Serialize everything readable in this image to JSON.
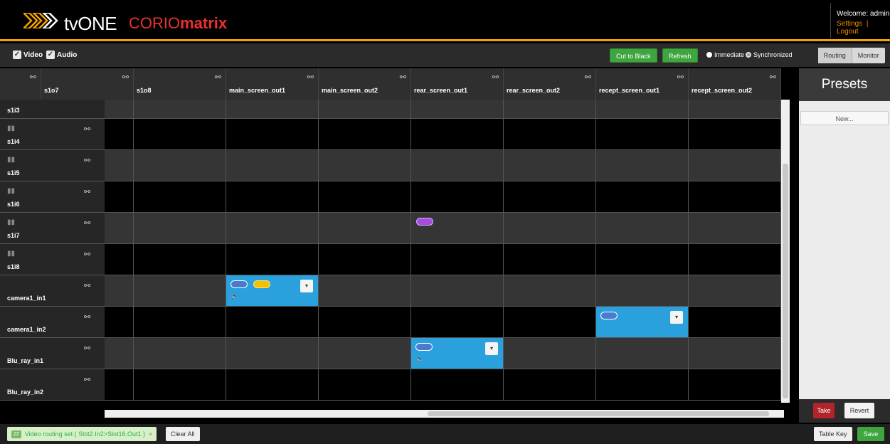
{
  "header": {
    "brand": "tvONE",
    "product_prefix": "CORIO",
    "product_suffix": "matrix",
    "welcome": "Welcome: admin",
    "settings": "Settings",
    "separator": "|",
    "logout": "Logout"
  },
  "toolbar": {
    "video_label": "Video",
    "audio_label": "Audio",
    "cut_to_black": "Cut to Black",
    "refresh": "Refresh",
    "immediate": "Immediate",
    "synchronized": "Synchronized",
    "routing": "Routing",
    "monitor": "Monitor"
  },
  "columns": [
    "s1o7",
    "s1o8",
    "main_screen_out1",
    "main_screen_out2",
    "rear_screen_out1",
    "rear_screen_out2",
    "recept_screen_out1",
    "recept_screen_out2"
  ],
  "rows": [
    "s1i3",
    "s1i4",
    "s1i5",
    "s1i6",
    "s1i7",
    "s1i8",
    "camera1_in1",
    "camera1_in2",
    "Blu_ray_in1",
    "Blu_ray_in2"
  ],
  "presets": {
    "title": "Presets",
    "new": "New...",
    "take": "Take",
    "revert": "Revert"
  },
  "footer": {
    "toast_count": "22",
    "toast_text": "Video routing set ( Slot2.In2>Slot16.Out1 )",
    "toast_close": "×",
    "clear_all": "Clear All",
    "table_key": "Table Key",
    "save": "Save"
  },
  "icons": {
    "logo": "tvone-chevrons-logo",
    "column_link": "link-icon",
    "row_bars": "signal-bars-icon",
    "audio": "speaker-icon",
    "dropdown": "caret-down-icon"
  }
}
